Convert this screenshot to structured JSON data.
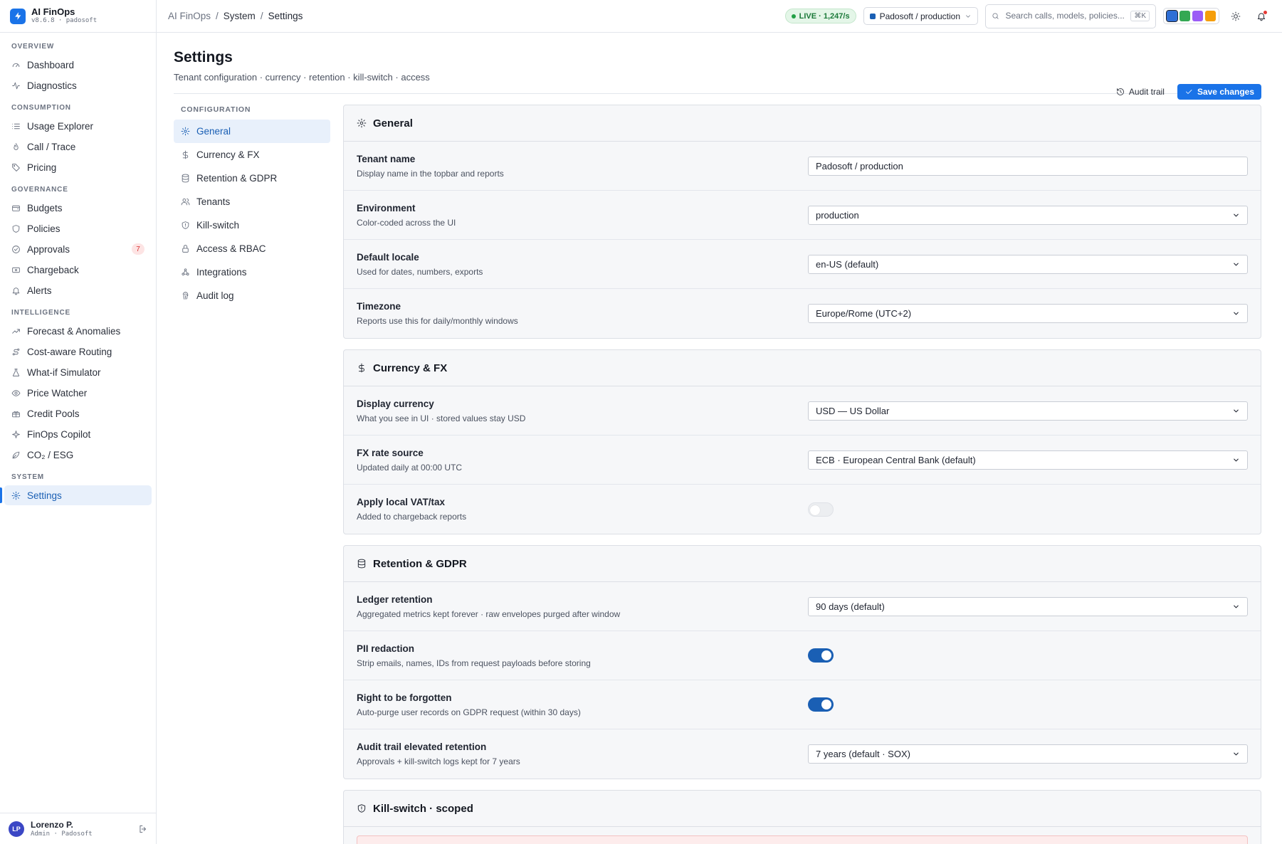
{
  "brand": {
    "name": "AI FinOps",
    "sub": "v8.6.8 · padosoft"
  },
  "sidebar": {
    "sections": {
      "overview": "OVERVIEW",
      "consumption": "CONSUMPTION",
      "governance": "GOVERNANCE",
      "intelligence": "INTELLIGENCE",
      "system": "SYSTEM"
    },
    "items": {
      "dashboard": "Dashboard",
      "diagnostics": "Diagnostics",
      "usage_explorer": "Usage Explorer",
      "call_trace": "Call / Trace",
      "pricing": "Pricing",
      "budgets": "Budgets",
      "policies": "Policies",
      "approvals": "Approvals",
      "approvals_badge": "7",
      "chargeback": "Chargeback",
      "alerts": "Alerts",
      "forecast": "Forecast & Anomalies",
      "routing": "Cost-aware Routing",
      "whatif": "What-if Simulator",
      "price_watcher": "Price Watcher",
      "credit_pools": "Credit Pools",
      "copilot": "FinOps Copilot",
      "co2": "CO₂ / ESG",
      "settings": "Settings"
    }
  },
  "user": {
    "initials": "LP",
    "name": "Lorenzo P.",
    "role": "Admin · Padosoft"
  },
  "topbar": {
    "crumbs": [
      "AI FinOps",
      "System",
      "Settings"
    ],
    "live": "LIVE · 1,247/s",
    "tenant": "Padosoft / production",
    "search_placeholder": "Search calls, models, policies...",
    "search_kbd": "⌘K",
    "swatch_colors": [
      "#2f6fd6",
      "#34a853",
      "#9b5cf6",
      "#f59e0b"
    ]
  },
  "header": {
    "title": "Settings",
    "subtitle": "Tenant configuration · currency · retention · kill-switch · access",
    "audit_trail": "Audit trail",
    "save": "Save changes"
  },
  "confnav": {
    "title": "CONFIGURATION",
    "items": [
      "General",
      "Currency & FX",
      "Retention & GDPR",
      "Tenants",
      "Kill-switch",
      "Access & RBAC",
      "Integrations",
      "Audit log"
    ]
  },
  "general": {
    "title": "General",
    "tenant_name": {
      "label": "Tenant name",
      "desc": "Display name in the topbar and reports",
      "value": "Padosoft / production"
    },
    "environment": {
      "label": "Environment",
      "desc": "Color-coded across the UI",
      "value": "production"
    },
    "locale": {
      "label": "Default locale",
      "desc": "Used for dates, numbers, exports",
      "value": "en-US (default)"
    },
    "timezone": {
      "label": "Timezone",
      "desc": "Reports use this for daily/monthly windows",
      "value": "Europe/Rome (UTC+2)"
    }
  },
  "currency": {
    "title": "Currency & FX",
    "display": {
      "label": "Display currency",
      "desc": "What you see in UI · stored values stay USD",
      "value": "USD — US Dollar"
    },
    "fx": {
      "label": "FX rate source",
      "desc": "Updated daily at 00:00 UTC",
      "value": "ECB · European Central Bank (default)"
    },
    "vat": {
      "label": "Apply local VAT/tax",
      "desc": "Added to chargeback reports",
      "on": false
    }
  },
  "retention": {
    "title": "Retention & GDPR",
    "ledger": {
      "label": "Ledger retention",
      "desc": "Aggregated metrics kept forever · raw envelopes purged after window",
      "value": "90 days (default)"
    },
    "pii": {
      "label": "PII redaction",
      "desc": "Strip emails, names, IDs from request payloads before storing",
      "on": true
    },
    "rtbf": {
      "label": "Right to be forgotten",
      "desc": "Auto-purge user records on GDPR request (within 30 days)",
      "on": true
    },
    "audit": {
      "label": "Audit trail elevated retention",
      "desc": "Approvals + kill-switch logs kept for 7 years",
      "value": "7 years (default · SOX)"
    }
  },
  "killswitch": {
    "title": "Kill-switch · scoped"
  }
}
